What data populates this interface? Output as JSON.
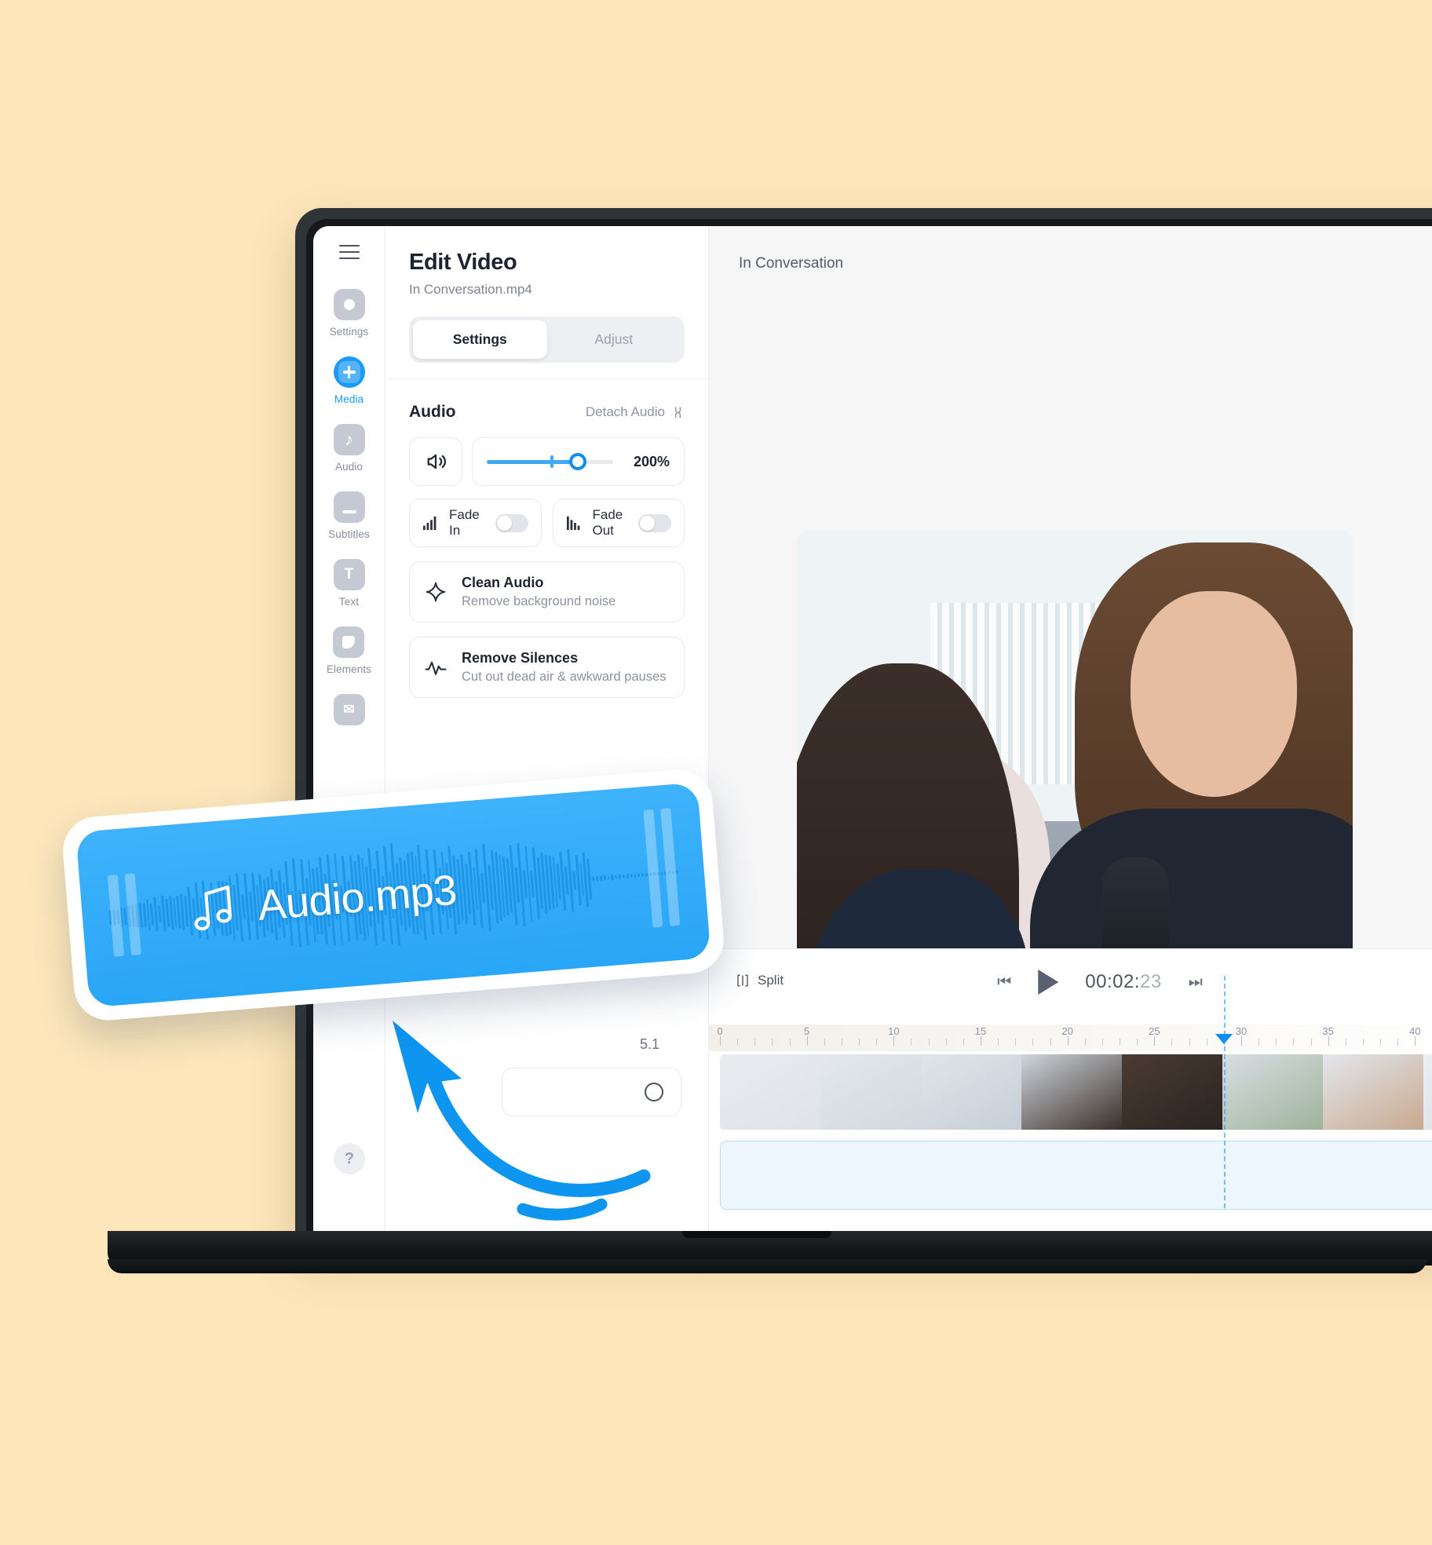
{
  "theme": {
    "background": "#FCE6BA",
    "accent": "#1a9afc",
    "accent_dark": "#0b8ef0"
  },
  "rail": {
    "menu_icon": "hamburger-icon",
    "items": [
      {
        "label": "Settings",
        "icon": "record-circle-icon",
        "active": false
      },
      {
        "label": "Media",
        "icon": "plus-icon",
        "active": true
      },
      {
        "label": "Audio",
        "icon": "music-note-icon",
        "active": false
      },
      {
        "label": "Subtitles",
        "icon": "subtitle-icon",
        "active": false
      },
      {
        "label": "Text",
        "icon": "text-t-icon",
        "active": false
      },
      {
        "label": "Elements",
        "icon": "sticker-icon",
        "active": false
      },
      {
        "label": "",
        "icon": "envelope-icon",
        "active": false
      }
    ],
    "help_label": "?"
  },
  "inspector": {
    "title": "Edit Video",
    "subtitle": "In Conversation.mp4",
    "tabs": [
      {
        "label": "Settings",
        "active": true
      },
      {
        "label": "Adjust",
        "active": false
      }
    ],
    "audio": {
      "section_title": "Audio",
      "detach_label": "Detach Audio",
      "volume_value": "200%",
      "volume_percent": 72,
      "fade_in": {
        "label": "Fade In",
        "on": false
      },
      "fade_out": {
        "label": "Fade Out",
        "on": false
      }
    },
    "tools": [
      {
        "title": "Clean Audio",
        "subtitle": "Remove background noise",
        "icon": "sparkle-icon"
      },
      {
        "title": "Remove Silences",
        "subtitle": "Cut out dead air & awkward pauses",
        "icon": "waveform-icon"
      }
    ],
    "partial_value": "5.1"
  },
  "preview": {
    "title": "In Conversation",
    "back_icon": "back-arrow-icon"
  },
  "timeline": {
    "tools": [
      {
        "label": "Split",
        "icon": "split-icon"
      }
    ],
    "transport": {
      "prev_icon": "skip-previous-icon",
      "play_icon": "play-icon",
      "next_icon": "skip-next-icon",
      "timecode_main": "00:02:",
      "timecode_frames": "23"
    },
    "ruler_labels": [
      "0",
      "5",
      "10",
      "15",
      "20",
      "25",
      "30",
      "35",
      "40"
    ],
    "playhead_position_seconds": 29
  },
  "floating_badge": {
    "file_name": "Audio.mp3",
    "icon": "music-note-icon",
    "color": "#2ea7f7"
  }
}
